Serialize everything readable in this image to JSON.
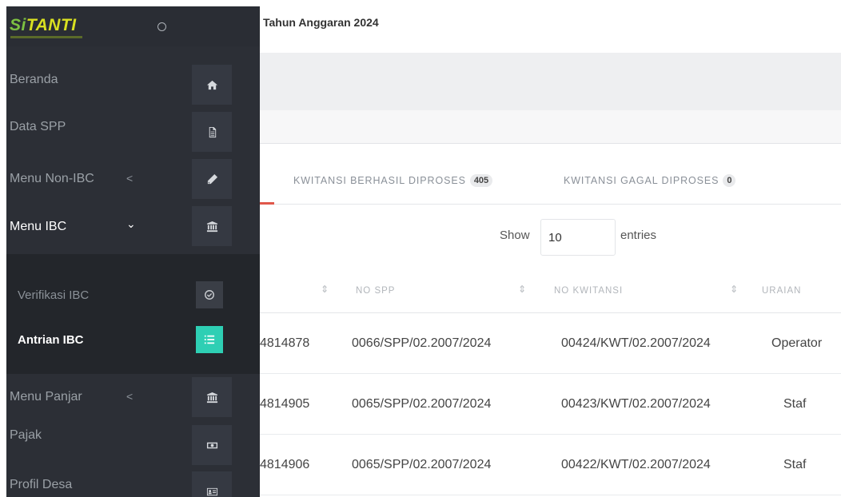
{
  "app": {
    "logo_text_s": "Si",
    "logo_text_rest": "TANTI",
    "colors": {
      "sidebar_bg": "#2c2f36",
      "accent_teal": "#2ecfb4",
      "tab_indicator": "#e0574a",
      "logo_yellow": "#d9e021"
    }
  },
  "header": {
    "title": "Tahun Anggaran 2024"
  },
  "sidebar": {
    "items": [
      {
        "label": "Beranda",
        "icon": "home-icon"
      },
      {
        "label": "Data SPP",
        "icon": "file-icon"
      },
      {
        "label": "Menu Non-IBC",
        "icon": "pen-icon",
        "chevron": "<"
      },
      {
        "label": "Menu IBC",
        "icon": "bank-icon",
        "chevron": "⌄"
      },
      {
        "label": "Menu Panjar",
        "icon": "bank-icon",
        "chevron": "<"
      },
      {
        "label": "Pajak",
        "icon": "money-icon"
      },
      {
        "label": "Profil Desa",
        "icon": "id-card-icon"
      }
    ],
    "submenu": [
      {
        "label": "Verifikasi IBC",
        "icon": "check-circle-icon"
      },
      {
        "label": "Antrian IBC",
        "icon": "list-icon"
      }
    ]
  },
  "tabs": [
    {
      "label": "KWITANSI BERHASIL DIPROSES",
      "count": "405"
    },
    {
      "label": "KWITANSI GAGAL DIPROSES",
      "count": "0"
    }
  ],
  "table_controls": {
    "show_label": "Show",
    "entries_value": "10",
    "entries_label": "entries"
  },
  "table": {
    "columns": [
      "NO SPP",
      "NO KWITANSI",
      "URAIAN"
    ],
    "rows": [
      {
        "c0": "4814878",
        "spp": "0066/SPP/02.2007/2024",
        "kwitansi": "00424/KWT/02.2007/2024",
        "uraian": "Operator"
      },
      {
        "c0": "4814905",
        "spp": "0065/SPP/02.2007/2024",
        "kwitansi": "00423/KWT/02.2007/2024",
        "uraian": "Staf"
      },
      {
        "c0": "4814906",
        "spp": "0065/SPP/02.2007/2024",
        "kwitansi": "00422/KWT/02.2007/2024",
        "uraian": "Staf"
      }
    ]
  }
}
